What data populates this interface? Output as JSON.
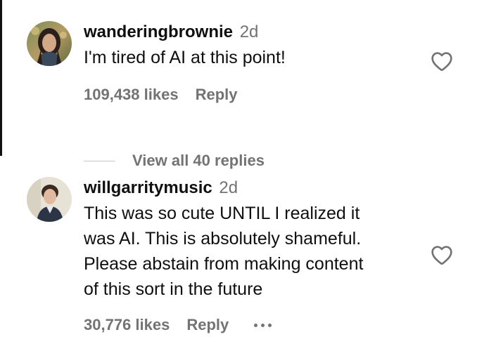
{
  "comments": [
    {
      "username": "wanderingbrownie",
      "time": "2d",
      "text_lines": [
        "I'm tired of AI at this point!"
      ],
      "likes": "109,438 likes",
      "reply_label": "Reply",
      "avatar_icon": "profile-photo"
    },
    {
      "username": "willgarritymusic",
      "time": "2d",
      "text_lines": [
        "This was so cute UNTIL I realized it",
        "was AI. This is absolutely shameful.",
        "Please abstain from making content",
        "of this sort in the future"
      ],
      "likes": "30,776 likes",
      "reply_label": "Reply",
      "avatar_icon": "profile-photo"
    }
  ],
  "view_replies": "View all 40 replies",
  "icons": {
    "like": "heart-outline-icon",
    "more": "more-options-icon"
  },
  "colors": {
    "text": "#0f0f0f",
    "secondary": "#737373",
    "divider": "#c7c7c7"
  }
}
